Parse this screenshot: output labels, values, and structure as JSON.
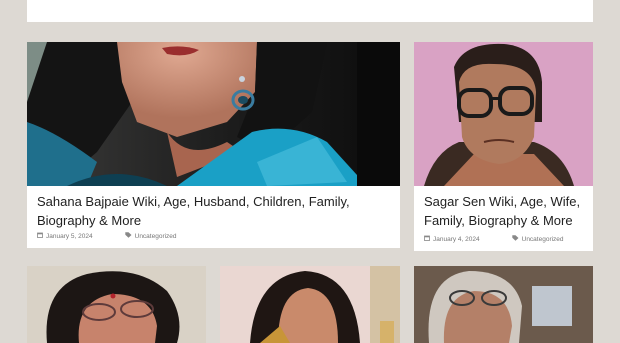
{
  "posts": [
    {
      "title": "Sahana Bajpaie Wiki, Age, Husband, Children, Family, Biography & More",
      "date": "January 5, 2024",
      "category": "Uncategorized"
    },
    {
      "title": "Sagar Sen Wiki, Age, Wife, Family, Biography & More",
      "date": "January 4, 2024",
      "category": "Uncategorized"
    }
  ],
  "icons": {
    "date": "calendar-icon",
    "category": "tag-icon"
  },
  "colors": {
    "page_background": "#ddd9d3",
    "card_background": "#ffffff",
    "title_text": "#222222",
    "meta_text": "#777777"
  }
}
